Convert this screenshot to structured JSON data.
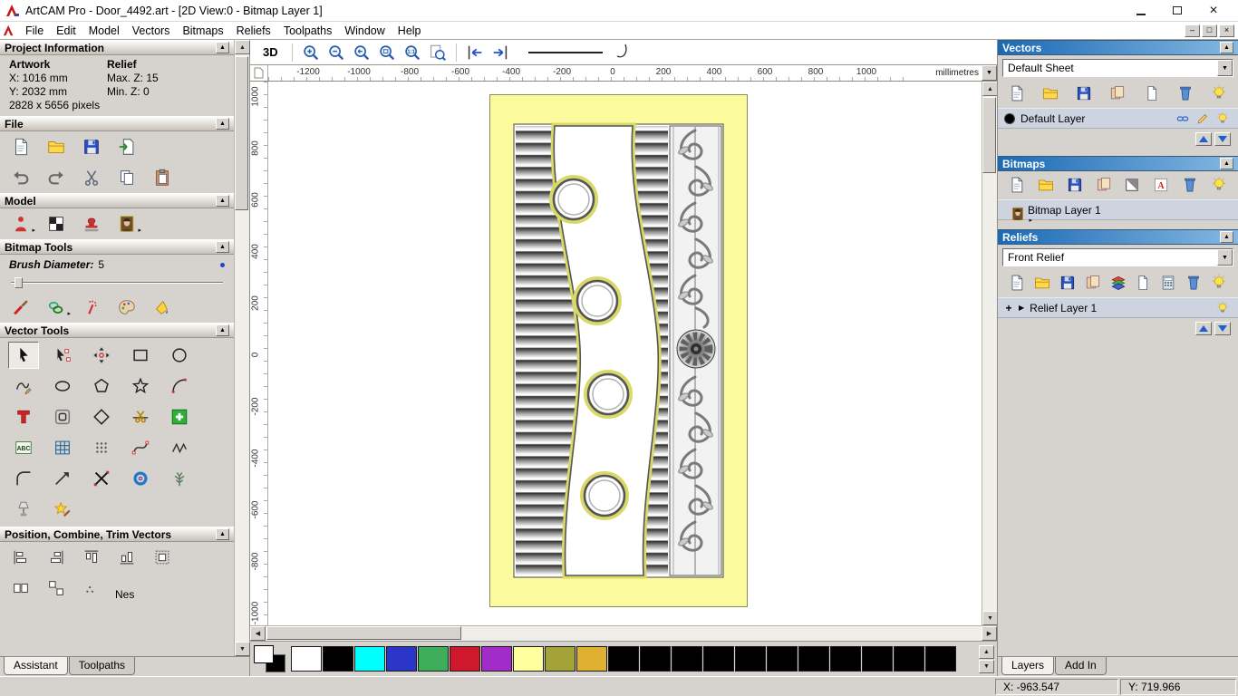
{
  "window": {
    "title": "ArtCAM Pro - Door_4492.art - [2D View:0 - Bitmap Layer 1]"
  },
  "menu": {
    "items": [
      "File",
      "Edit",
      "Model",
      "Vectors",
      "Bitmaps",
      "Reliefs",
      "Toolpaths",
      "Window",
      "Help"
    ]
  },
  "left_panel": {
    "project_information": {
      "title": "Project Information",
      "artwork_label": "Artwork",
      "relief_label": "Relief",
      "x": "X: 1016 mm",
      "y": "Y: 2032 mm",
      "max_z": "Max. Z: 15",
      "min_z": "Min. Z: 0",
      "pixels": "2828 x 5656 pixels"
    },
    "file": {
      "title": "File",
      "icons_row1": [
        "new-document",
        "open-folder",
        "save",
        "import-model"
      ],
      "icons_row2": [
        "undo",
        "redo",
        "cut",
        "copy",
        "paste"
      ]
    },
    "model": {
      "title": "Model",
      "icons": [
        "model-figure",
        "checkerboard",
        "stamp",
        "portrait"
      ]
    },
    "bitmap_tools": {
      "title": "Bitmap Tools",
      "brush_label": "Brush Diameter:",
      "brush_value": "5",
      "icons": [
        "paint-brush",
        "shape-draw",
        "spray",
        "palette",
        "flood-fill"
      ]
    },
    "vector_tools": {
      "title": "Vector Tools",
      "rows": [
        [
          "select-cursor",
          "edit-nodes",
          "transform",
          "rect-tool",
          "circle-tool"
        ],
        [
          "freehand",
          "ellipse-tool",
          "polygon-tool",
          "star-tool",
          "arc-tool"
        ],
        [
          "text-tool",
          "offset-tool",
          "diamond-tool",
          "snip-tool",
          "paste-green"
        ],
        [
          "abc-block",
          "grid-tool",
          "dots-tool",
          "curve-tool",
          "zigzag-tool"
        ],
        [
          "fillet-tool",
          "arrow-tool",
          "slice-tool",
          "spiral-tool",
          "branch-tool"
        ],
        [
          "lamp-tool",
          "star-wizard"
        ]
      ]
    },
    "position_tools": {
      "title": "Position, Combine, Trim Vectors",
      "icons_row1": [
        "align-left",
        "align-right",
        "align-top",
        "align-bottom",
        "align-boxes"
      ],
      "icons_row2": [
        "align-pair",
        "align-grid2",
        "dots-mini"
      ],
      "partial_label": "Nes"
    },
    "tabs": [
      {
        "label": "Assistant"
      },
      {
        "label": "Toolpaths"
      }
    ]
  },
  "canvas": {
    "toolbar": {
      "view_label": "3D",
      "zoom_icons": [
        "zoom-in",
        "zoom-out",
        "zoom-prev",
        "zoom-rect",
        "zoom-one",
        "zoom-page"
      ],
      "pan_icons": [
        "pan-in-left",
        "pan-in-right"
      ]
    },
    "ruler": {
      "unit": "millimetres",
      "h_ticks": [
        "-1200",
        "-1000",
        "-800",
        "-600",
        "-400",
        "-200",
        "0",
        "200",
        "400",
        "600",
        "800",
        "1000"
      ],
      "v_ticks": [
        "1000",
        "800",
        "600",
        "400",
        "200",
        "0",
        "-200",
        "-400",
        "-600",
        "-800",
        "-1000"
      ]
    },
    "palette": {
      "colors": [
        "#ffffff",
        "#000000",
        "#00ffff",
        "#2b35c8",
        "#3fae5a",
        "#d0182c",
        "#a12cc8",
        "#ffffa0",
        "#a3a339",
        "#e0b030",
        "#000000",
        "#000000",
        "#000000",
        "#000000",
        "#000000",
        "#000000",
        "#000000",
        "#000000",
        "#000000",
        "#000000",
        "#000000"
      ]
    },
    "door": {
      "background": "#fbfb9e"
    }
  },
  "right_panel": {
    "vectors": {
      "title": "Vectors",
      "sheet": "Default Sheet",
      "icons": [
        "new-document",
        "open-folder",
        "save",
        "merge-tan",
        "page-small",
        "delete-blue",
        "bulb"
      ],
      "layer": {
        "name": "Default Layer"
      },
      "layer_icons": [
        "link-chain",
        "edit-pencil",
        "bulb"
      ]
    },
    "bitmaps": {
      "title": "Bitmaps",
      "icons": [
        "new-document",
        "open-folder",
        "save",
        "merge-tan",
        "contrast-square",
        "letter-a",
        "delete-blue",
        "bulb"
      ],
      "layer": {
        "name": "Bitmap Layer 1"
      },
      "layer_icons_left": [
        "portrait"
      ]
    },
    "reliefs": {
      "title": "Reliefs",
      "combo": "Front Relief",
      "icons": [
        "new-document",
        "open-folder",
        "save",
        "merge-tan",
        "layer-colors",
        "page-small",
        "calculator",
        "delete-blue",
        "bulb"
      ],
      "layer": {
        "name": "Relief Layer 1",
        "expander": "+",
        "arrow": "▶"
      },
      "layer_icons_right": [
        "bulb"
      ]
    },
    "tabs": [
      {
        "label": "Layers"
      },
      {
        "label": "Add In"
      }
    ]
  },
  "status_bar": {
    "x": "X: -963.547",
    "y": "Y: 719.966"
  }
}
